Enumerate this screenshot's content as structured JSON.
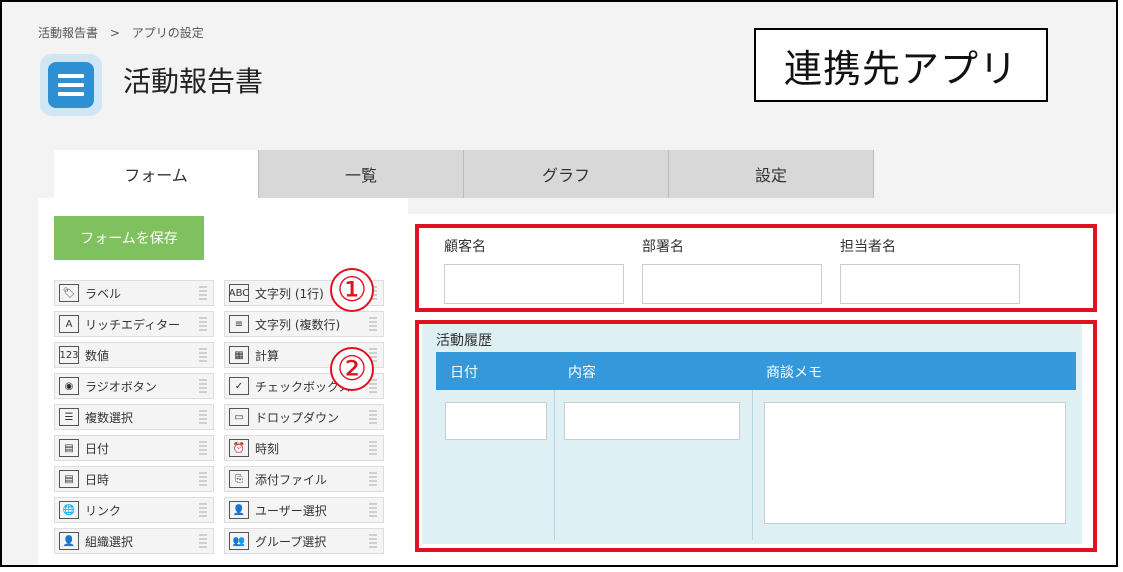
{
  "breadcrumb": {
    "app": "活動報告書",
    "sep": ">",
    "page": "アプリの設定"
  },
  "app": {
    "title": "活動報告書"
  },
  "callout": {
    "text": "連携先アプリ"
  },
  "tabs": [
    {
      "label": "フォーム",
      "active": true
    },
    {
      "label": "一覧"
    },
    {
      "label": "グラフ"
    },
    {
      "label": "設定"
    }
  ],
  "save_button": {
    "label": "フォームを保存"
  },
  "palette": {
    "left": [
      {
        "label": "ラベル",
        "icon": "tag-icon",
        "glyph": "🏷"
      },
      {
        "label": "リッチエディター",
        "icon": "rich-editor-icon",
        "glyph": "A"
      },
      {
        "label": "数値",
        "icon": "number-icon",
        "glyph": "123"
      },
      {
        "label": "ラジオボタン",
        "icon": "radio-icon",
        "glyph": "◉"
      },
      {
        "label": "複数選択",
        "icon": "multi-select-icon",
        "glyph": "☰"
      },
      {
        "label": "日付",
        "icon": "date-icon",
        "glyph": "▤"
      },
      {
        "label": "日時",
        "icon": "datetime-icon",
        "glyph": "▤"
      },
      {
        "label": "リンク",
        "icon": "link-icon",
        "glyph": "🌐"
      },
      {
        "label": "組織選択",
        "icon": "org-select-icon",
        "glyph": "👤"
      }
    ],
    "right": [
      {
        "label": "文字列 (1行)",
        "icon": "text-single-icon",
        "glyph": "ABC"
      },
      {
        "label": "文字列 (複数行)",
        "icon": "text-multi-icon",
        "glyph": "≡"
      },
      {
        "label": "計算",
        "icon": "calc-icon",
        "glyph": "▦"
      },
      {
        "label": "チェックボックス",
        "icon": "checkbox-icon",
        "glyph": "✓"
      },
      {
        "label": "ドロップダウン",
        "icon": "dropdown-icon",
        "glyph": "▭"
      },
      {
        "label": "時刻",
        "icon": "clock-icon",
        "glyph": "⏰"
      },
      {
        "label": "添付ファイル",
        "icon": "attachment-icon",
        "glyph": "⎘"
      },
      {
        "label": "ユーザー選択",
        "icon": "user-select-icon",
        "glyph": "👤"
      },
      {
        "label": "グループ選択",
        "icon": "group-select-icon",
        "glyph": "👥"
      }
    ]
  },
  "annotations": {
    "one": "①",
    "two": "②"
  },
  "fields": {
    "customer": "顧客名",
    "department": "部署名",
    "person": "担当者名"
  },
  "subtable": {
    "title": "活動履歴",
    "columns": [
      "日付",
      "内容",
      "商談メモ"
    ]
  },
  "colors": {
    "accent_red": "#e0121f",
    "save_green": "#7fc05f",
    "header_blue": "#3498db"
  }
}
